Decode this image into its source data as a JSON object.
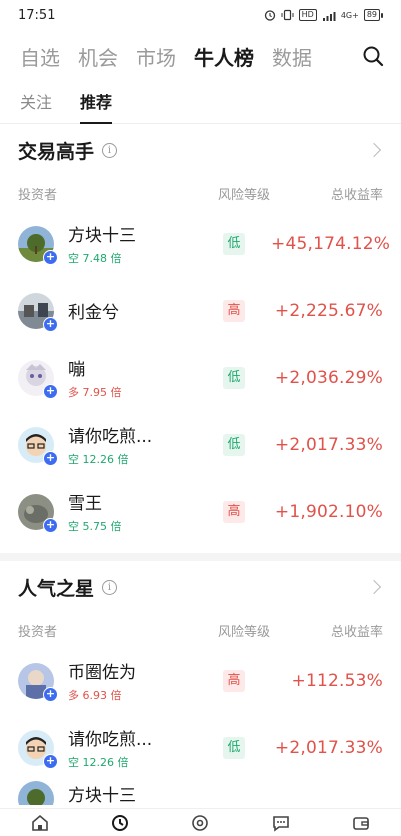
{
  "status": {
    "time": "17:51",
    "icons": [
      "alarm-icon",
      "vibrate-icon",
      "hd-icon",
      "signal-icon",
      "4g-signal-icon"
    ],
    "hd_label": "HD",
    "net_label": "4G+",
    "battery": "89"
  },
  "nav": {
    "tabs": [
      "自选",
      "机会",
      "市场",
      "牛人榜",
      "数据"
    ],
    "active_index": 3
  },
  "subnav": {
    "tabs": [
      "关注",
      "推荐"
    ],
    "active_index": 1
  },
  "sections": [
    {
      "title": "交易高手",
      "info": "i",
      "headers": {
        "investor": "投资者",
        "risk": "风险等级",
        "return": "总收益率"
      },
      "rows": [
        {
          "name": "方块十三",
          "leverage": "空 7.48 倍",
          "direction": "short",
          "risk": "低",
          "risk_level": "low",
          "return": "+45,174.12%"
        },
        {
          "name": "利金兮",
          "leverage": "",
          "direction": "short",
          "risk": "高",
          "risk_level": "high",
          "return": "+2,225.67%"
        },
        {
          "name": "嘣",
          "leverage": "多 7.95 倍",
          "direction": "long",
          "risk": "低",
          "risk_level": "low",
          "return": "+2,036.29%"
        },
        {
          "name": "请你吃煎...",
          "leverage": "空 12.26 倍",
          "direction": "short",
          "risk": "低",
          "risk_level": "low",
          "return": "+2,017.33%"
        },
        {
          "name": "雪王",
          "leverage": "空 5.75 倍",
          "direction": "short",
          "risk": "高",
          "risk_level": "high",
          "return": "+1,902.10%"
        }
      ]
    },
    {
      "title": "人气之星",
      "info": "i",
      "headers": {
        "investor": "投资者",
        "risk": "风险等级",
        "return": "总收益率"
      },
      "rows": [
        {
          "name": "币圈佐为",
          "leverage": "多 6.93 倍",
          "direction": "long",
          "risk": "高",
          "risk_level": "high",
          "return": "+112.53%"
        },
        {
          "name": "请你吃煎...",
          "leverage": "空 12.26 倍",
          "direction": "short",
          "risk": "低",
          "risk_level": "low",
          "return": "+2,017.33%"
        },
        {
          "name": "方块十三",
          "leverage": "",
          "direction": "short",
          "risk": "",
          "risk_level": "low",
          "return": ""
        }
      ]
    }
  ],
  "colors": {
    "up": "#e0524a",
    "low_risk": "#20a86f",
    "badge": "#3d6cf0"
  },
  "bottom_nav": [
    "home-icon",
    "trade-icon",
    "discover-icon",
    "chat-icon",
    "wallet-icon"
  ]
}
